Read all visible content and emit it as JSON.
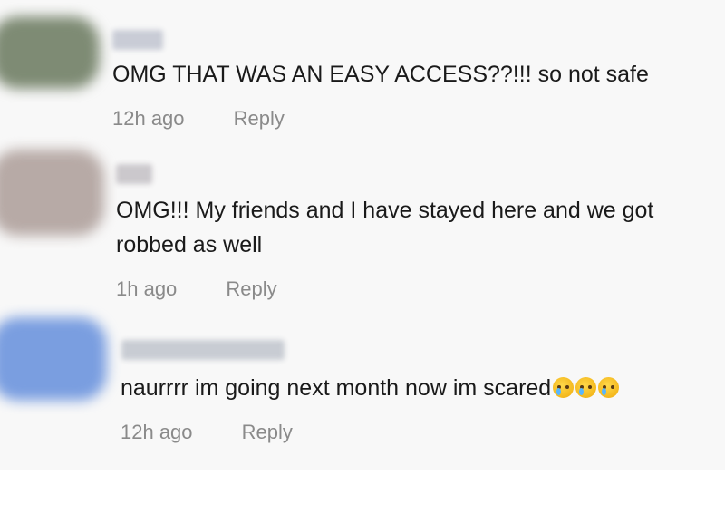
{
  "comments": [
    {
      "text": "OMG THAT WAS AN EASY ACCESS??!!! so not safe",
      "time": "12h ago",
      "reply_label": "Reply",
      "avatar_color": "#7e8b74",
      "username_color": "#c9ccd6"
    },
    {
      "text": "OMG!!! My friends and I have stayed here and we got\nrobbed as well",
      "time": "1h ago",
      "reply_label": "Reply",
      "avatar_color": "#b7aaa6",
      "username_color": "#cbc8cc"
    },
    {
      "text": "naurrrr im going next month now im scared",
      "emoji": [
        "crying-face",
        "crying-face",
        "crying-face"
      ],
      "time": "12h ago",
      "reply_label": "Reply",
      "avatar_color": "#7a9ee0",
      "username_color": "#c8ccd3"
    }
  ]
}
